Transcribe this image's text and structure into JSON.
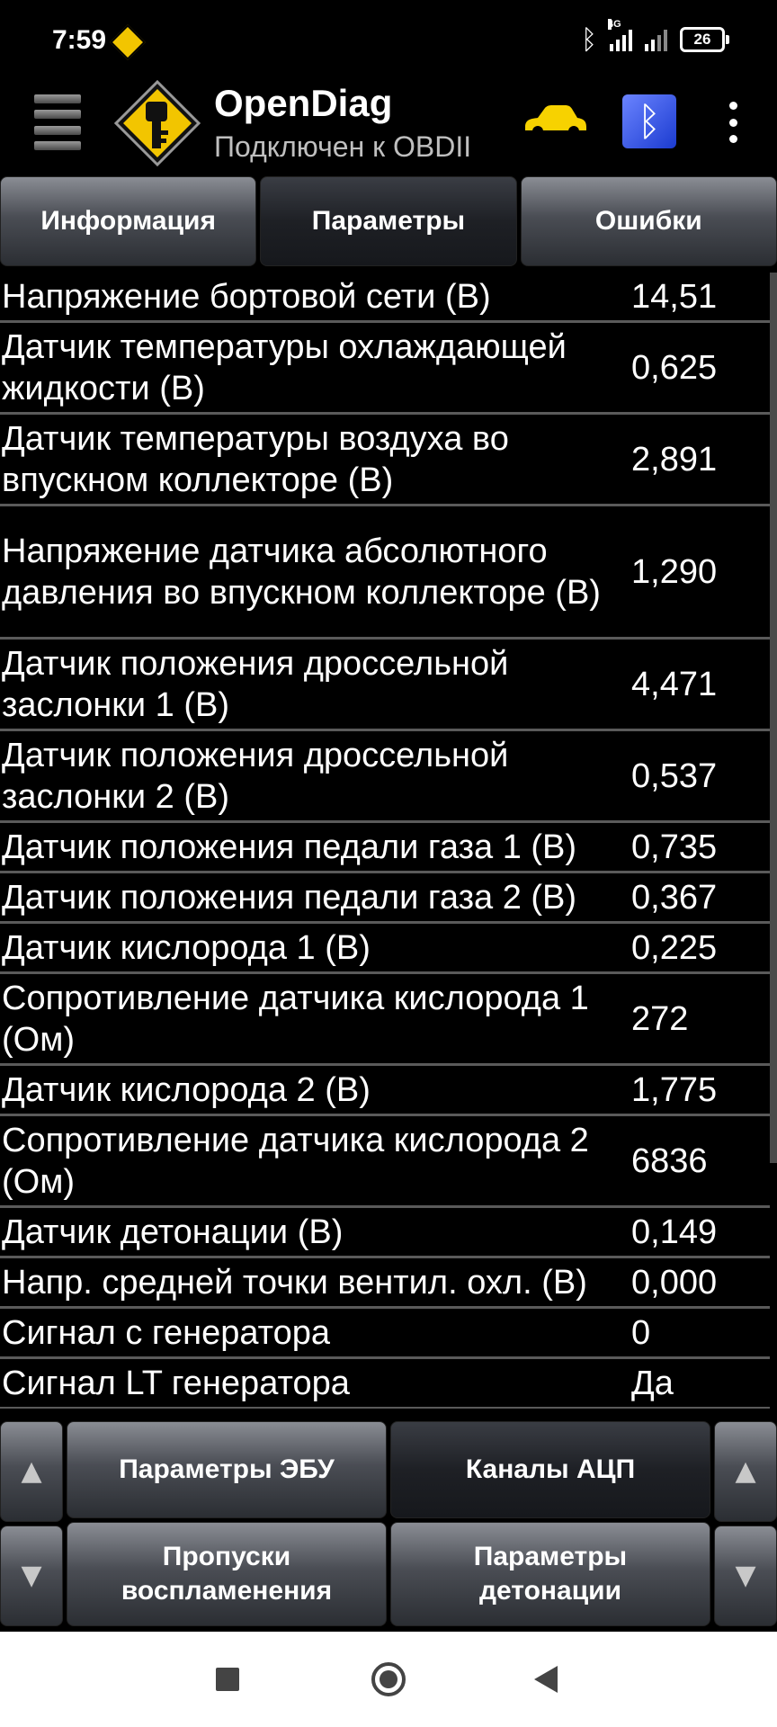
{
  "status_bar": {
    "time": "7:59",
    "network_type": "4G",
    "battery": "26"
  },
  "app_bar": {
    "title": "OpenDiag",
    "subtitle": "Подключен к OBDII"
  },
  "tabs": [
    {
      "label": "Информация",
      "active": false
    },
    {
      "label": "Параметры",
      "active": true
    },
    {
      "label": "Ошибки",
      "active": false
    }
  ],
  "parameters": [
    {
      "name": "Напряжение бортовой сети (В)",
      "value": "14,51"
    },
    {
      "name": "Датчик температуры охлаждающей жидкости (В)",
      "value": "0,625"
    },
    {
      "name": "Датчик температуры воздуха во впускном коллекторе (В)",
      "value": "2,891"
    },
    {
      "name": "Напряжение датчика абсолютного давления во впускном коллекторе (В)",
      "value": "1,290"
    },
    {
      "name": "Датчик положения дроссельной заслонки 1 (В)",
      "value": "4,471"
    },
    {
      "name": "Датчик положения дроссельной заслонки 2 (В)",
      "value": "0,537"
    },
    {
      "name": "Датчик положения педали газа 1 (В)",
      "value": "0,735"
    },
    {
      "name": "Датчик положения педали газа 2 (В)",
      "value": "0,367"
    },
    {
      "name": "Датчик кислорода 1 (В)",
      "value": "0,225"
    },
    {
      "name": "Сопротивление датчика кислорода 1 (Ом)",
      "value": "272"
    },
    {
      "name": "Датчик кислорода 2 (В)",
      "value": "1,775"
    },
    {
      "name": "Сопротивление датчика кислорода 2 (Ом)",
      "value": "6836"
    },
    {
      "name": "Датчик детонации (В)",
      "value": "0,149"
    },
    {
      "name": "Напр. средней точки вентил. охл. (В)",
      "value": "0,000"
    },
    {
      "name": "Сигнал с генератора",
      "value": "0"
    },
    {
      "name": "Сигнал LT генератора",
      "value": "Да"
    }
  ],
  "bottom_panel": {
    "up_arrow": "▲",
    "down_arrow": "▼",
    "ecu_params": "Параметры ЭБУ",
    "adc_channels": "Каналы АЦП",
    "misfires": "Пропуски воспламенения",
    "knock_params": "Параметры детонации"
  },
  "colors": {
    "background": "#000000",
    "row_divider": "#5a5a5a",
    "logo_yellow": "#f2c500",
    "car_yellow": "#f7d200",
    "bt_blue": "#2d4fe0"
  }
}
